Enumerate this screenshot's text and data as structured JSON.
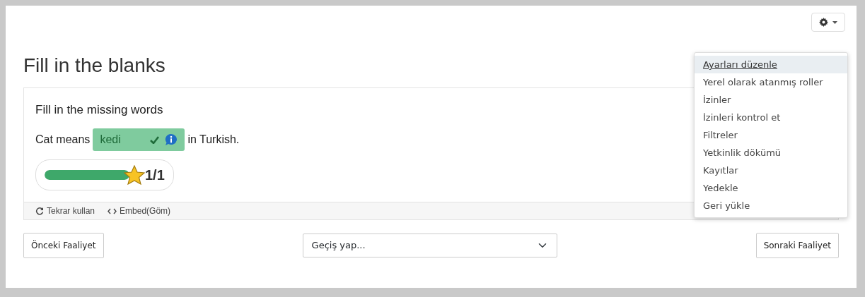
{
  "page_title": "Fill in the blanks",
  "task": {
    "heading": "Fill in the missing words",
    "before": "Cat means",
    "answer": "kedi",
    "correct": true,
    "after": "in Turkish.",
    "score": {
      "level": 1,
      "text": "1/1"
    }
  },
  "actions": [
    {
      "kind": "reuse",
      "label": "Tekrar kullan"
    },
    {
      "kind": "embed",
      "label": "Embed(Göm)"
    }
  ],
  "navigation": {
    "previous": "Önceki Faaliyet",
    "jump": {
      "placeholder": "Geçiş yap..."
    },
    "next": "Sonraki Faaliyet"
  },
  "settings_menu": {
    "expanded": true,
    "items": [
      {
        "label": "Ayarları düzenle",
        "selected": true
      },
      {
        "label": "Yerel olarak atanmış roller",
        "selected": false
      },
      {
        "label": "İzinler",
        "selected": false
      },
      {
        "label": "İzinleri kontrol et",
        "selected": false
      },
      {
        "label": "Filtreler",
        "selected": false
      },
      {
        "label": "Yetkinlik dökümü",
        "selected": false
      },
      {
        "label": "Kayıtlar",
        "selected": false
      },
      {
        "label": "Yedekle",
        "selected": false
      },
      {
        "label": "Geri yükle",
        "selected": false
      }
    ]
  }
}
